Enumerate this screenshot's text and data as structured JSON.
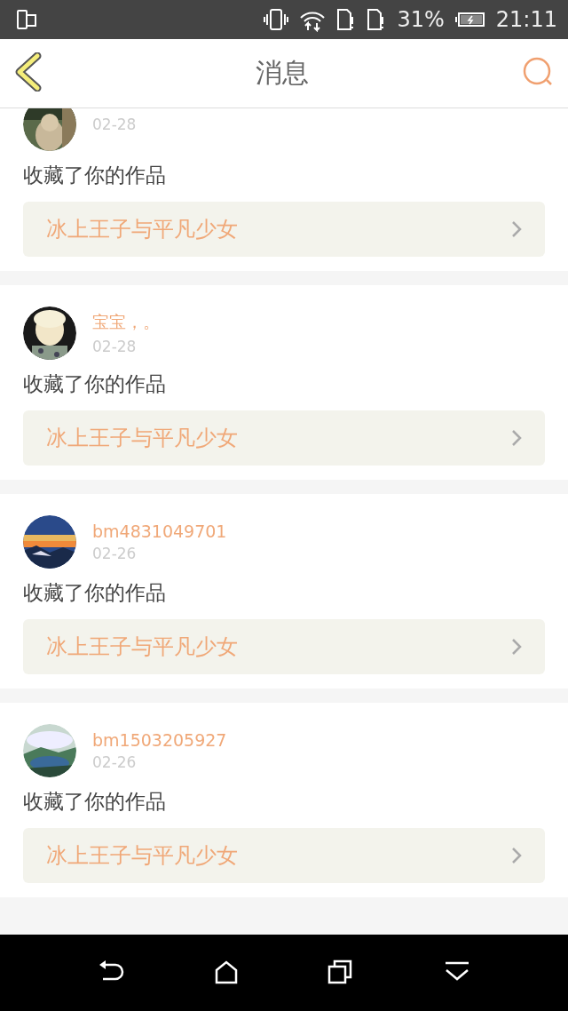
{
  "status_bar": {
    "battery": "31%",
    "time": "21:11"
  },
  "header": {
    "title": "消息"
  },
  "messages": [
    {
      "date": "02-28",
      "action": "收藏了你的作品",
      "work": "冰上王子与平凡少女"
    },
    {
      "name": "宝宝，。",
      "date": "02-28",
      "action": "收藏了你的作品",
      "work": "冰上王子与平凡少女"
    },
    {
      "name": "bm4831049701",
      "date": "02-26",
      "action": "收藏了你的作品",
      "work": "冰上王子与平凡少女"
    },
    {
      "name": "bm1503205927",
      "date": "02-26",
      "action": "收藏了你的作品",
      "work": "冰上王子与平凡少女"
    }
  ]
}
